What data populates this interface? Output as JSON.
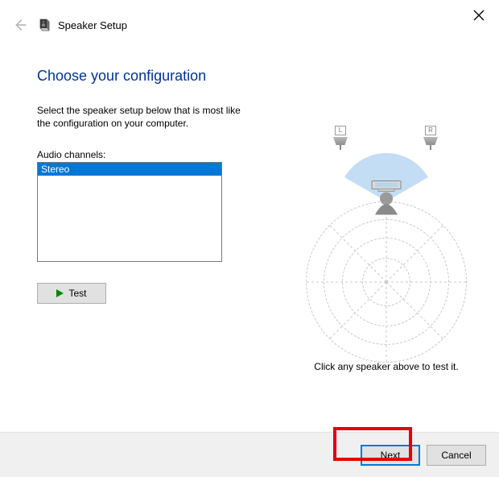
{
  "window": {
    "title": "Speaker Setup"
  },
  "page": {
    "heading": "Choose your configuration",
    "description_line1": "Select the speaker setup below that is most like",
    "description_line2": "the configuration on your computer.",
    "channels_label": "Audio channels:",
    "test_label": "Test",
    "hint": "Click any speaker above to test it."
  },
  "channels": {
    "options": [
      "Stereo"
    ],
    "selected": "Stereo"
  },
  "diagram": {
    "left_speaker_label": "L",
    "right_speaker_label": "R"
  },
  "footer": {
    "next_label": "Next",
    "cancel_label": "Cancel"
  }
}
